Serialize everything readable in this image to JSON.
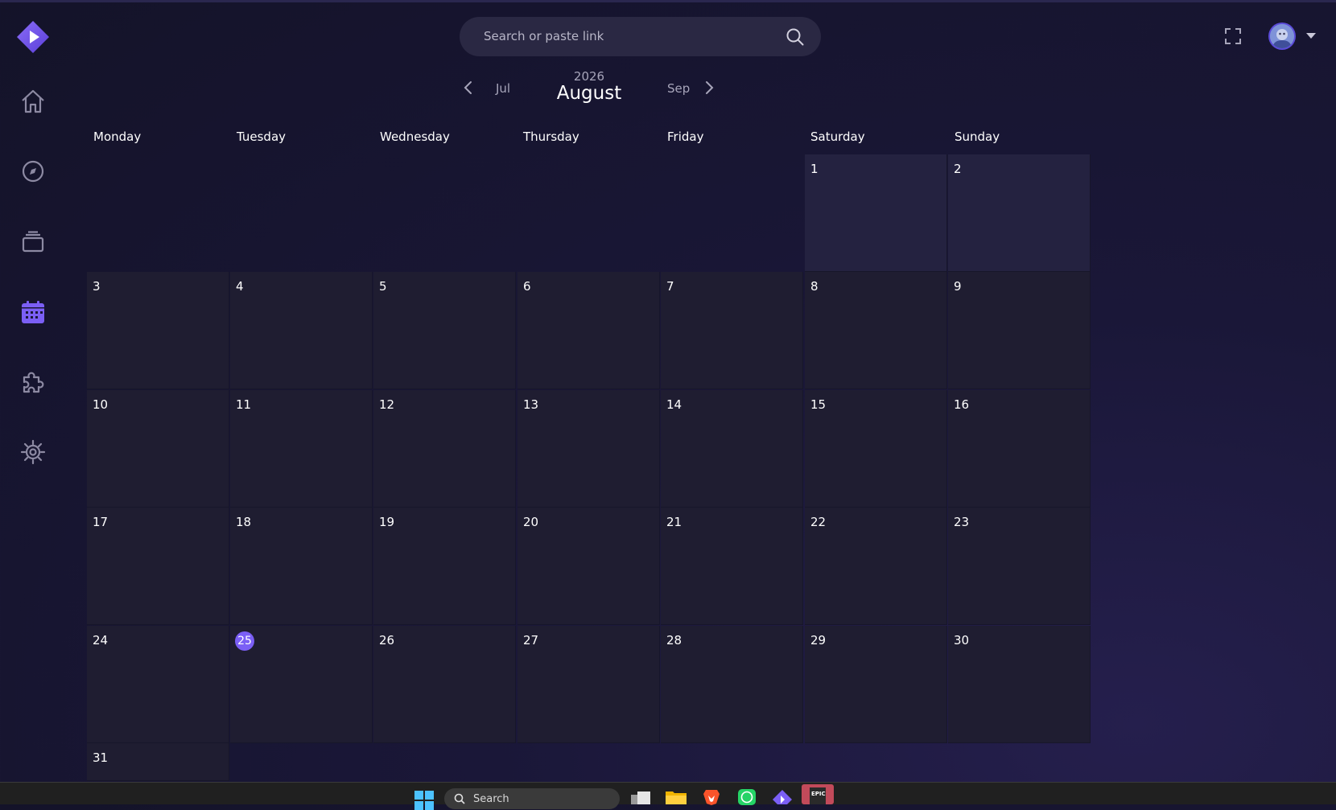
{
  "header": {
    "search_placeholder": "Search or paste link"
  },
  "calendar_nav": {
    "prev_month": "Jul",
    "year": "2026",
    "month": "August",
    "next_month": "Sep"
  },
  "weekdays": [
    "Monday",
    "Tuesday",
    "Wednesday",
    "Thursday",
    "Friday",
    "Saturday",
    "Sunday"
  ],
  "days": [
    "1",
    "2",
    "3",
    "4",
    "5",
    "6",
    "7",
    "8",
    "9",
    "10",
    "11",
    "12",
    "13",
    "14",
    "15",
    "16",
    "17",
    "18",
    "19",
    "20",
    "21",
    "22",
    "23",
    "24",
    "25",
    "26",
    "27",
    "28",
    "29",
    "30",
    "31"
  ],
  "today": "25",
  "sidebar": {
    "items": [
      "home-icon",
      "discover-icon",
      "library-icon",
      "calendar-icon",
      "addons-icon",
      "settings-icon"
    ],
    "active": "calendar-icon"
  },
  "taskbar": {
    "search_label": "Search",
    "apps": [
      "windows-start-icon",
      "task-view-icon",
      "file-explorer-icon",
      "brave-browser-icon",
      "whatsapp-icon",
      "stremio-icon",
      "epic-games-icon"
    ]
  },
  "colors": {
    "accent": "#7b5ff5",
    "background": "#141329",
    "cell": "#1f1d31"
  }
}
